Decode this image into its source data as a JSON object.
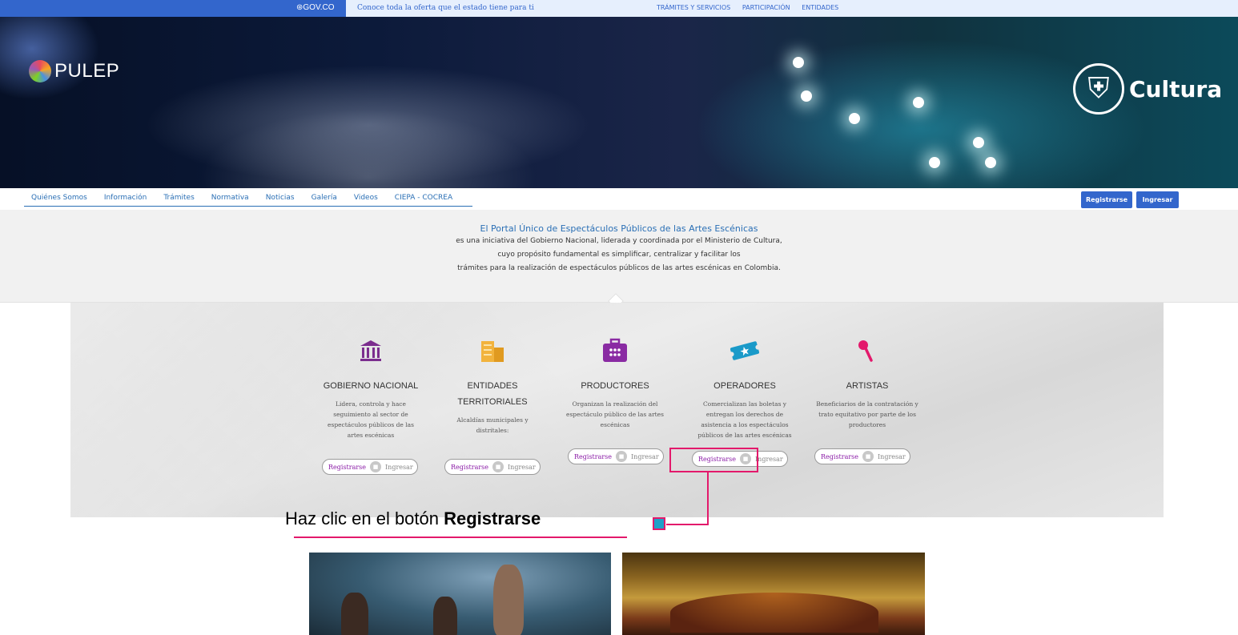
{
  "govbar": {
    "brand": "GOV.CO",
    "slogan": "Conoce toda la oferta que el estado tiene para ti",
    "links": [
      "TRÁMITES Y SERVICIOS",
      "PARTICIPACIÓN",
      "ENTIDADES"
    ]
  },
  "banner": {
    "logo_left": "PULEP",
    "logo_right": "Cultura"
  },
  "nav": {
    "items": [
      "Quiénes Somos",
      "Información",
      "Trámites",
      "Normativa",
      "Noticias",
      "Galería",
      "Videos",
      "CIEPA - COCREA"
    ]
  },
  "header_buttons": {
    "register": "Registrarse",
    "login": "Ingresar"
  },
  "intro": {
    "title": "El Portal Único de Espectáculos Públicos de las Artes Escénicas",
    "lines": [
      "es una iniciativa del Gobierno Nacional, liderada y coordinada por el Ministerio de Cultura,",
      "cuyo propósito fundamental es simplificar, centralizar y facilitar los",
      "trámites para la realización de espectáculos públicos de las artes escénicas en Colombia."
    ]
  },
  "roles": [
    {
      "name": "GOBIERNO NACIONAL",
      "desc": "Lidera, controla y hace seguimiento al sector de espectáculos públicos de las artes escénicas",
      "icon": "building-icon",
      "color": "#7b2d8e"
    },
    {
      "name": "ENTIDADES TERRITORIALES",
      "desc": "Alcaldías municipales y distritales:",
      "icon": "buildings-icon",
      "color": "#f2b33d"
    },
    {
      "name": "PRODUCTORES",
      "desc": "Organizan la realización del espectáculo público de las artes escénicas",
      "icon": "briefcase-icon",
      "color": "#8a2ba3"
    },
    {
      "name": "OPERADORES",
      "desc": "Comercializan las boletas y entregan los derechos de asistencia a los espectáculos públicos de las artes escénicas",
      "icon": "ticket-icon",
      "color": "#1a9ac9"
    },
    {
      "name": "ARTISTAS",
      "desc": "Beneficiarios de la contratación y trato equitativo por parte de los productores",
      "icon": "microphone-icon",
      "color": "#e3196b"
    }
  ],
  "pill": {
    "register": "Registrarse",
    "login": "Ingresar"
  },
  "annotation": {
    "text_prefix": "Haz clic en el botón ",
    "text_bold": "Registrarse"
  },
  "colors": {
    "gov_blue": "#3366cc",
    "highlight": "#e3196b",
    "link_blue": "#2a6fb5"
  }
}
